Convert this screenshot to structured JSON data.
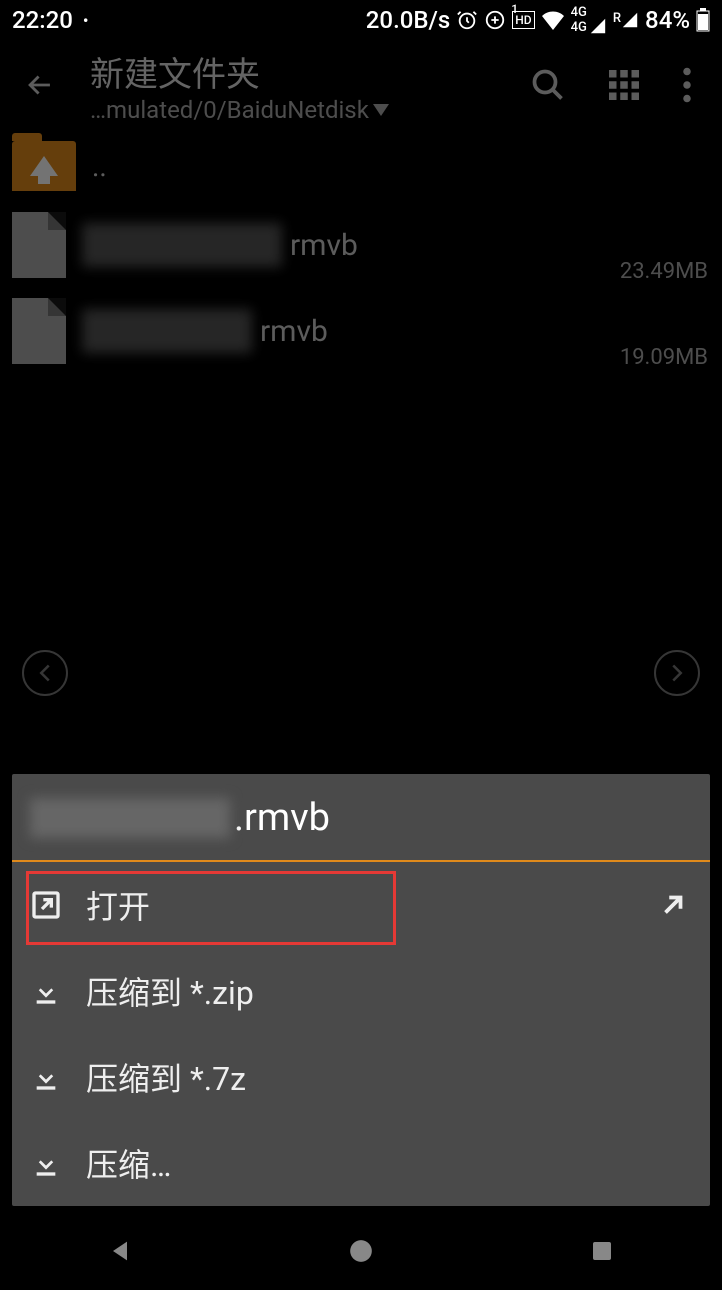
{
  "status": {
    "time": "22:20",
    "speed": "20.0B/s",
    "battery": "84%"
  },
  "appbar": {
    "title": "新建文件夹",
    "path": "…mulated/0/BaiduNetdisk"
  },
  "up_label": "..",
  "files": [
    {
      "ext": "rmvb",
      "size": "23.49MB"
    },
    {
      "ext": "rmvb",
      "size": "19.09MB"
    }
  ],
  "sheet": {
    "title_ext": ".rmvb",
    "items": [
      {
        "label": "打开",
        "icon": "open",
        "arrow": true
      },
      {
        "label": "压缩到 *.zip",
        "icon": "download"
      },
      {
        "label": "压缩到 *.7z",
        "icon": "download"
      },
      {
        "label": "压缩…",
        "icon": "download"
      }
    ]
  }
}
